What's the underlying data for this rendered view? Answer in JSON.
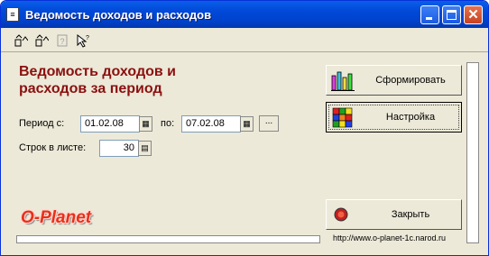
{
  "window": {
    "title": "Ведомость доходов и расходов",
    "title_icon": "form-icon"
  },
  "toolbar": {
    "icons": [
      "open-up-icon",
      "save-up-icon",
      "help-icon",
      "context-help-icon"
    ]
  },
  "form": {
    "heading_line1": "Ведомость доходов и",
    "heading_line2": "расходов за период",
    "period_from_label": "Период с:",
    "period_from_value": "01.02.08",
    "period_to_label": "по:",
    "period_to_value": "07.02.08",
    "dots_label": "...",
    "rows_label": "Строк в листе:",
    "rows_value": "30"
  },
  "buttons": {
    "generate_label": "Сформировать",
    "settings_label": "Настройка",
    "close_label": "Закрыть"
  },
  "footer": {
    "logo_text": "O-Planet",
    "link_text": "http://www.o-planet-1c.narod.ru"
  },
  "colors": {
    "heading": "#8B1010",
    "logo": "#E8301A",
    "titlebar": "#0148D8",
    "window_bg": "#ECE9D8"
  }
}
